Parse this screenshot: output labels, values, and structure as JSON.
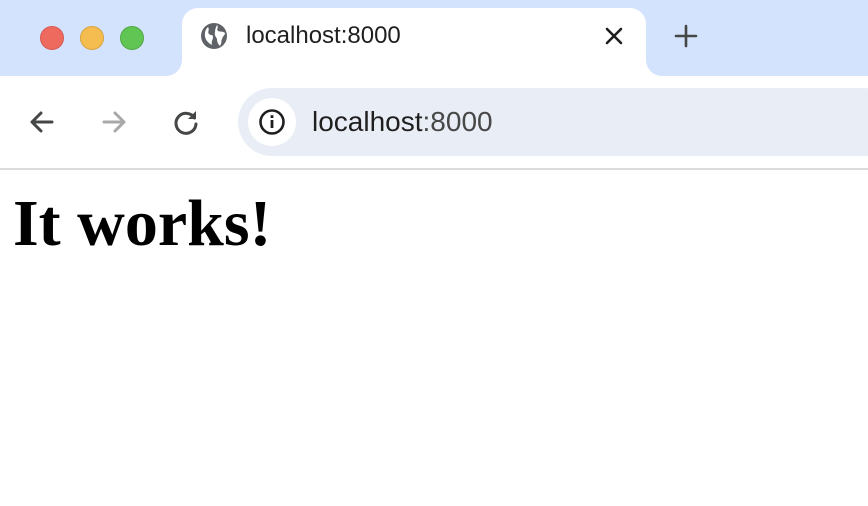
{
  "tab": {
    "title": "localhost:8000",
    "favicon": "globe-icon"
  },
  "toolbar": {
    "back_icon": "arrow-left-icon",
    "forward_icon": "arrow-right-icon",
    "reload_icon": "reload-icon",
    "site_info_icon": "info-icon"
  },
  "address_bar": {
    "host": "localhost",
    "port": ":8000"
  },
  "page": {
    "heading": "It works!"
  },
  "colors": {
    "tabstrip_bg": "#d3e3fd",
    "omnibox_bg": "#e9eef6",
    "close": "#ee6a5f",
    "minimize": "#f5bd4f",
    "maximize": "#61c554"
  }
}
